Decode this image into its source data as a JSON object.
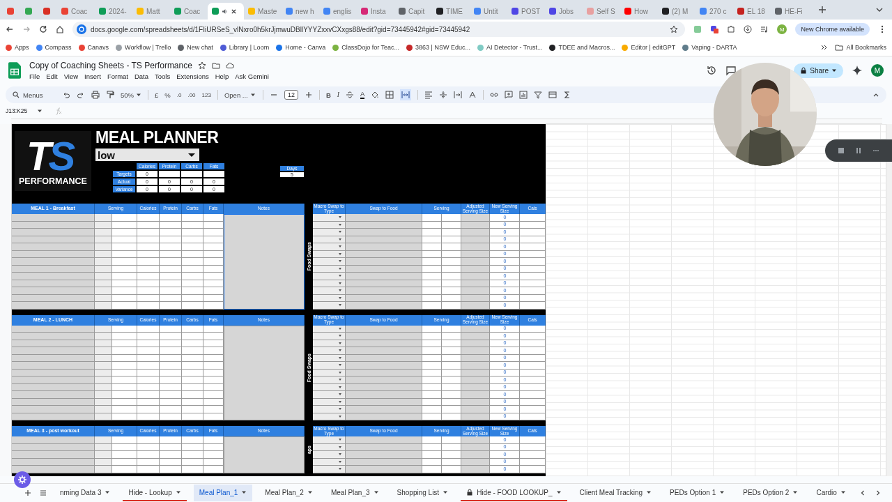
{
  "browser": {
    "tabs": [
      {
        "color": "#e94235",
        "selected": false
      },
      {
        "color": "#34a853",
        "selected": false
      },
      {
        "color": "#d93025",
        "selected": false
      },
      {
        "label": "Coac",
        "color": "#ea4335",
        "selected": false
      },
      {
        "label": "2024-",
        "color": "#0f9d58",
        "selected": false
      },
      {
        "label": "Matt",
        "color": "#fbbc04",
        "selected": false
      },
      {
        "label": "Coac",
        "color": "#0f9d58",
        "selected": false
      },
      {
        "color": "#0f9d58",
        "selected": true
      },
      {
        "label": "Maste",
        "color": "#fbbc04",
        "selected": false
      },
      {
        "label": "new h",
        "color": "#4285f4",
        "selected": false
      },
      {
        "label": "englis",
        "color": "#4285f4",
        "selected": false
      },
      {
        "label": "Insta",
        "color": "#d62976",
        "selected": false
      },
      {
        "label": "Capit",
        "color": "#5f6368",
        "selected": false
      },
      {
        "label": "TIME",
        "color": "#202124",
        "selected": false
      },
      {
        "label": "Untit",
        "color": "#4285f4",
        "selected": false
      },
      {
        "label": "POST",
        "color": "#4f46e5",
        "selected": false
      },
      {
        "label": "Jobs",
        "color": "#4f46e5",
        "selected": false
      },
      {
        "label": "Self S",
        "color": "#e8a0a0",
        "selected": false
      },
      {
        "label": "How",
        "color": "#ff0000",
        "selected": false
      },
      {
        "label": "(2) M",
        "color": "#202124",
        "selected": false
      },
      {
        "label": "270 c",
        "color": "#4285f4",
        "selected": false
      },
      {
        "label": "EL 18",
        "color": "#c5221f",
        "selected": false
      },
      {
        "label": "HE-Fi",
        "color": "#5f6368",
        "selected": false
      }
    ],
    "url": "docs.google.com/spreadsheets/d/1FIiURSeS_vlNxro0h5krJjmwuDBllYYYZxxvCXxgs88/edit?gid=73445942#gid=73445942",
    "profile_letter": "M",
    "update_label": "New Chrome available",
    "bookmarks": [
      {
        "label": "Apps",
        "color": "#ea4335"
      },
      {
        "label": "Compass",
        "color": "#4285f4"
      },
      {
        "label": "Canavs",
        "color": "#e94235"
      },
      {
        "label": "Workflow | Trello",
        "color": "#9aa0a6"
      },
      {
        "label": "New chat",
        "color": "#5f6368"
      },
      {
        "label": "Library | Loom",
        "color": "#4f5bd5"
      },
      {
        "label": "Home - Canva",
        "color": "#1a73e8"
      },
      {
        "label": "ClassDojo for Teac...",
        "color": "#7cb342"
      },
      {
        "label": "3863 | NSW Educ...",
        "color": "#c62828"
      },
      {
        "label": "AI Detector - Trust...",
        "color": "#80cbc4"
      },
      {
        "label": "TDEE and Macros...",
        "color": "#202124"
      },
      {
        "label": "Editor | editGPT",
        "color": "#f9ab00"
      },
      {
        "label": "Vaping - DARTA",
        "color": "#607d8b"
      }
    ],
    "all_bookmarks": "All Bookmarks"
  },
  "doc": {
    "title": "Copy of Coaching Sheets - TS Performance",
    "menu": [
      "File",
      "Edit",
      "View",
      "Insert",
      "Format",
      "Data",
      "Tools",
      "Extensions",
      "Help",
      "Ask Gemini"
    ],
    "share": "Share",
    "avatar_letter": "M"
  },
  "toolbar": {
    "search_placeholder": "Menus",
    "zoom": "50%",
    "currency": "£",
    "percent": "%",
    "decrease_decimals": ".0",
    "increase_decimals": ".00",
    "number_format": "123",
    "font": "Open ...",
    "font_size": "12",
    "bold": "B",
    "italic": "I",
    "text_color": "A"
  },
  "formula_bar": {
    "range": "J13:K25"
  },
  "planner": {
    "logo_mark": "TS",
    "logo_word": "PERFORMANCE",
    "title": "MEAL PLANNER",
    "plan_type": "low",
    "macro_columns": [
      "Calories",
      "Protein",
      "Carbs",
      "Fats"
    ],
    "macro_rows": [
      {
        "label": "Targets",
        "values": [
          "0"
        ]
      },
      {
        "label": "Actual",
        "values": [
          "0",
          "0",
          "0",
          "0"
        ]
      },
      {
        "label": "Variance",
        "values": [
          "0",
          "0",
          "0",
          "0"
        ]
      }
    ],
    "days": {
      "label": "Days",
      "value": "5"
    }
  },
  "meals": [
    {
      "columns": [
        "MEAL 1 - Breakfast",
        "Serving",
        "Calories",
        "Protein",
        "Carbs",
        "Fats",
        "Notes"
      ],
      "notes_selected": true,
      "food_swaps_label": "Food Swaps",
      "swap_columns": [
        "Macro Swap to Type",
        "Swap to Food",
        "Serving",
        "Adjusted Serving Size",
        "New Serving Size",
        "Cals"
      ],
      "rows": [
        {
          "new_serving": "0"
        },
        {
          "new_serving": "0"
        },
        {
          "new_serving": "0"
        },
        {
          "new_serving": "0"
        },
        {
          "new_serving": "0"
        },
        {
          "new_serving": "0"
        },
        {
          "new_serving": "0"
        },
        {
          "new_serving": "0"
        },
        {
          "new_serving": "0"
        },
        {
          "new_serving": "0"
        },
        {
          "new_serving": "0"
        },
        {
          "new_serving": "0"
        },
        {
          "new_serving": "0"
        }
      ]
    },
    {
      "columns": [
        "MEAL 2 - LUNCH",
        "Serving",
        "Calories",
        "Protein",
        "Carbs",
        "Fats",
        "Notes"
      ],
      "notes_selected": false,
      "food_swaps_label": "Food Swaps",
      "swap_columns": [
        "Macro Swap to Type",
        "Swap to Food",
        "Serving",
        "Adjusted Serving Size",
        "New Serving Size",
        "Cals"
      ],
      "rows": [
        {
          "new_serving": "0"
        },
        {
          "new_serving": "0"
        },
        {
          "new_serving": "0"
        },
        {
          "new_serving": "0"
        },
        {
          "new_serving": "0"
        },
        {
          "new_serving": "0"
        },
        {
          "new_serving": "0"
        },
        {
          "new_serving": "0"
        },
        {
          "new_serving": "0"
        },
        {
          "new_serving": "0"
        },
        {
          "new_serving": "0"
        },
        {
          "new_serving": "0"
        },
        {
          "new_serving": "0"
        }
      ]
    },
    {
      "columns": [
        "MEAL 3 - post workout",
        "Serving",
        "Calories",
        "Protein",
        "Carbs",
        "Fats",
        "Notes"
      ],
      "notes_selected": false,
      "food_swaps_label": "aps",
      "swap_columns": [
        "Macro Swap to Type",
        "Swap to Food",
        "Serving",
        "Adjusted Serving Size",
        "New Serving Size",
        "Cals"
      ],
      "rows": [
        {
          "new_serving": "0"
        },
        {
          "new_serving": "0"
        },
        {
          "new_serving": "0"
        },
        {
          "new_serving": "0"
        },
        {
          "new_serving": "0"
        }
      ]
    }
  ],
  "sheet_tabs": [
    {
      "label": "nming Data 3",
      "selected": false,
      "locked": false
    },
    {
      "label": "Hide - Lookup",
      "selected": false,
      "locked": false,
      "color": "#d93025"
    },
    {
      "label": "Meal Plan_1",
      "selected": true,
      "locked": false
    },
    {
      "label": "Meal Plan_2",
      "selected": false,
      "locked": false
    },
    {
      "label": "Meal Plan_3",
      "selected": false,
      "locked": false
    },
    {
      "label": "Shopping List",
      "selected": false,
      "locked": false
    },
    {
      "label": "Hide - FOOD LOOKUP_",
      "selected": false,
      "locked": true,
      "color": "#d93025"
    },
    {
      "label": "Client Meal Tracking",
      "selected": false,
      "locked": false
    },
    {
      "label": "PEDs Option 1",
      "selected": false,
      "locked": false
    },
    {
      "label": "PEDs Option 2",
      "selected": false,
      "locked": false
    },
    {
      "label": "Cardio",
      "selected": false,
      "locked": false
    }
  ]
}
